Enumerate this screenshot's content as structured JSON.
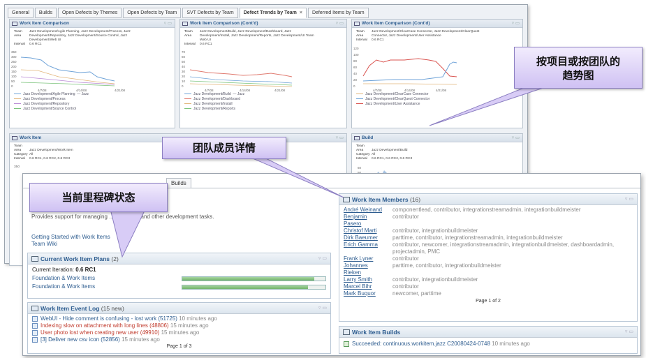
{
  "tabs": [
    {
      "label": "General"
    },
    {
      "label": "Builds"
    },
    {
      "label": "Open Defects by Themes"
    },
    {
      "label": "Open Defects by Team"
    },
    {
      "label": "SVT Defects by Team"
    },
    {
      "label": "Defect Trends by Team",
      "close": "×"
    },
    {
      "label": "Deferred Items by Team"
    }
  ],
  "bg_widgets": {
    "w1": {
      "title": "Work Item Comparison",
      "team_k": "Team",
      "team_v": "Jazz Development/Agile Planning, Jazz Development/Process, Jazz",
      "area_k": "Area",
      "area_v": "Development/Repository, Jazz Development/Source Control, Jazz",
      "area_v2": "Development/Web UI",
      "int_k": "Interval",
      "int_v": "0.6 RC1",
      "yticks": [
        "350",
        "300",
        "250",
        "200",
        "150",
        "100",
        "50",
        "0"
      ],
      "xticks": [
        "4/7/08",
        "4/14/08",
        "4/21/08"
      ],
      "legend": [
        "Jazz Development/Agile Planning",
        "Jazz Development/Process",
        "Jazz Development/Repository",
        "Jazz Development/Source Control"
      ],
      "legend_more": "Jazz"
    },
    "w2": {
      "title": "Work Item Comparison (Cont'd)",
      "team_k": "Team",
      "team_v": "Jazz Development/Build, Jazz Development/Dashboard, Jazz",
      "area_k": "Area",
      "area_v": "Development/Install, Jazz Development/Reports, Jazz Development/UI Team",
      "area_v2": "Web UI",
      "int_k": "Interval",
      "int_v": "0.6 RC1",
      "yticks": [
        "70",
        "60",
        "50",
        "40",
        "30",
        "20",
        "10",
        "0"
      ],
      "xticks": [
        "4/7/08",
        "4/14/08",
        "4/21/08"
      ],
      "legend": [
        "Jazz Development/Build",
        "Jazz Development/Dashboard",
        "Jazz Development/Install",
        "Jazz Development/Reports"
      ],
      "legend_more": "Jazz"
    },
    "w3": {
      "title": "Work Item Comparison (Cont'd)",
      "team_k": "Team",
      "team_v": "Jazz Development/ClearCase Connector, Jazz Development/ClearQuest",
      "area_k": "Area",
      "area_v": "Connector, Jazz Development/User Assistance",
      "int_k": "Interval",
      "int_v": "0.6 RC1",
      "yticks": [
        "120",
        "100",
        "80",
        "60",
        "40",
        "20",
        "0"
      ],
      "xticks": [
        "4/7/08",
        "4/14/08",
        "4/21/08"
      ],
      "legend": [
        "Jazz Development/ClearCase Connector",
        "Jazz Development/ClearQuest Connector",
        "Jazz Development/User Assistance"
      ]
    },
    "w4": {
      "title": "Work Item",
      "team_k": "Team Area",
      "team_v": "Jazz Development/Work Item",
      "cat_k": "Category",
      "cat_v": "All",
      "int_k": "Interval",
      "int_v": "0.6 RC1, 0.6 RC2, 0.6 RC3",
      "ytick": "350"
    },
    "w5": {
      "title": "Build",
      "team_k": "Team Area",
      "team_v": "Jazz Development/Build",
      "cat_k": "Category",
      "cat_v": "All",
      "int_k": "Interval",
      "int_v": "0.6 RC1, 0.6 RC2, 0.6 RC3",
      "yticks": [
        "60",
        "50",
        "30"
      ]
    }
  },
  "fg": {
    "builds_tab": "Builds",
    "desc": "requests, and other development tasks.",
    "desc_prefix": "Provides support for managing",
    "links": [
      "Getting Started with Work Items",
      "Team Wiki"
    ],
    "plans": {
      "title": "Current Work Item Plans",
      "count": "(2)",
      "iteration_label": "Current Iteration:",
      "iteration": "0.6 RC1",
      "rows": [
        {
          "name": "Foundation & Work Items",
          "progress": 0.92
        },
        {
          "name": "Foundation & Work Items",
          "progress": 0.88
        }
      ]
    },
    "log": {
      "title": "Work Item Event Log",
      "count": "(15 new)",
      "items": [
        {
          "text": "WebUI - Hide comment is confusing - lost work (51725)",
          "time": "10 minutes ago",
          "color": "#2d5c8f"
        },
        {
          "text": "Indexing slow on attachment with long lines (48806)",
          "time": "15 minutes ago",
          "color": "#c0392b"
        },
        {
          "text": "User photo lost when creating new user (49910)",
          "time": "15 minutes ago",
          "color": "#c0392b"
        },
        {
          "text": "[3] Deliver new csv icon (52856)",
          "time": "15 minutes ago",
          "color": "#2d5c8f"
        }
      ],
      "pager": "Page 1 of 3"
    },
    "members": {
      "title": "Work Item Members",
      "count": "(16)",
      "items": [
        {
          "name": "André Weinand",
          "roles": "componentlead, contributor, integrationstreamadmin, integrationbuildmeister"
        },
        {
          "name": "Benjamin Pasero",
          "roles": "contributor"
        },
        {
          "name": "Christof Marti",
          "roles": "contributor, integrationbuildmeister"
        },
        {
          "name": "Dirk Baeumer",
          "roles": "parttime, contributor, integrationstreamadmin, integrationbuildmeister"
        },
        {
          "name": "Erich Gamma",
          "roles": "contributor, newcomer, integrationstreamadmin, integrationbuildmeister, dashboardadmin, projectadmin, PMC"
        },
        {
          "name": "Frank Lyner",
          "roles": "contributor"
        },
        {
          "name": "Johannes Rieken",
          "roles": "parttime, contributor, integrationbuildmeister"
        },
        {
          "name": "Larry Smith",
          "roles": "contributor, integrationbuildmeister"
        },
        {
          "name": "Marcel Bihr",
          "roles": "contributor"
        },
        {
          "name": "Mark Buquor",
          "roles": "newcomer, parttime"
        }
      ],
      "pager": "Page 1 of 2"
    },
    "builds": {
      "title": "Work Item Builds",
      "item": "Succeeded: continuous.workitem.jazz C20080424-0748",
      "time": "10 minutes ago"
    }
  },
  "callouts": {
    "trends": "按项目或按团队的趋势图",
    "members": "团队成员详情",
    "milestone": "当前里程碑状态"
  }
}
